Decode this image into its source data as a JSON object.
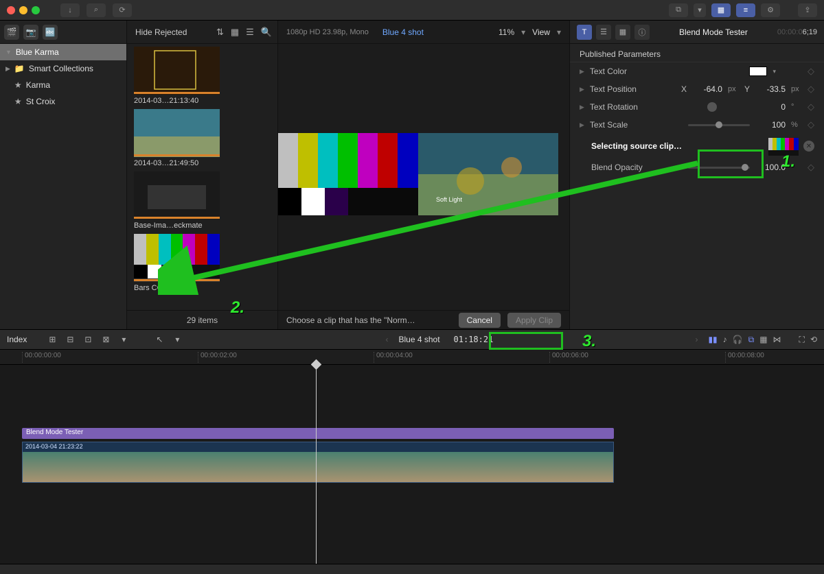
{
  "titlebar": {
    "buttons": [
      "↓",
      "⌕",
      "⟳"
    ],
    "right": [
      "⧉",
      "▾",
      "▦",
      "≡",
      "⚙",
      "⇪"
    ]
  },
  "sidebar": {
    "filter_label": "Hide Rejected",
    "library": "Blue Karma",
    "items": [
      "Smart Collections",
      "Karma",
      "St Croix"
    ]
  },
  "browser": {
    "clips": [
      {
        "label": "2014-03…21:13:40"
      },
      {
        "label": "2014-03…21:49:50"
      },
      {
        "label": "Base-Ima…eckmate"
      },
      {
        "label": "Bars CC"
      }
    ],
    "footer": "29 items"
  },
  "viewer": {
    "format": "1080p HD 23.98p, Mono",
    "title": "Blue 4 shot",
    "zoom": "11%",
    "view_label": "View",
    "overlay": "Soft Light",
    "footer_text": "Choose a clip that has the \"Norm…",
    "cancel": "Cancel",
    "apply": "Apply Clip"
  },
  "inspector": {
    "title": "Blend Mode Tester",
    "timecode_gray": "00:00:0",
    "timecode": "6;19",
    "section": "Published Parameters",
    "params": {
      "text_color": "Text Color",
      "text_position": "Text Position",
      "pos_x_label": "X",
      "pos_x": "-64.0",
      "pos_x_unit": "px",
      "pos_y_label": "Y",
      "pos_y": "-33.5",
      "pos_y_unit": "px",
      "text_rotation": "Text Rotation",
      "rot_val": "0",
      "rot_unit": "°",
      "text_scale": "Text Scale",
      "scale_val": "100",
      "scale_unit": "%",
      "selecting": "Selecting source clip…",
      "blend_opacity": "Blend Opacity",
      "opacity_val": "100.0"
    }
  },
  "tl_toolbar": {
    "index": "Index",
    "title": "Blue 4 shot",
    "tc": "01:18:21"
  },
  "ruler": [
    "00:00:00:00",
    "00:00:02:00",
    "00:00:04:00",
    "00:00:06:00",
    "00:00:08:00"
  ],
  "timeline": {
    "title_clip": "Blend Mode Tester",
    "video_clip_label": "2014-03-04 21:23:22"
  },
  "annotations": {
    "n1": "1.",
    "n2": "2.",
    "n3": "3."
  }
}
